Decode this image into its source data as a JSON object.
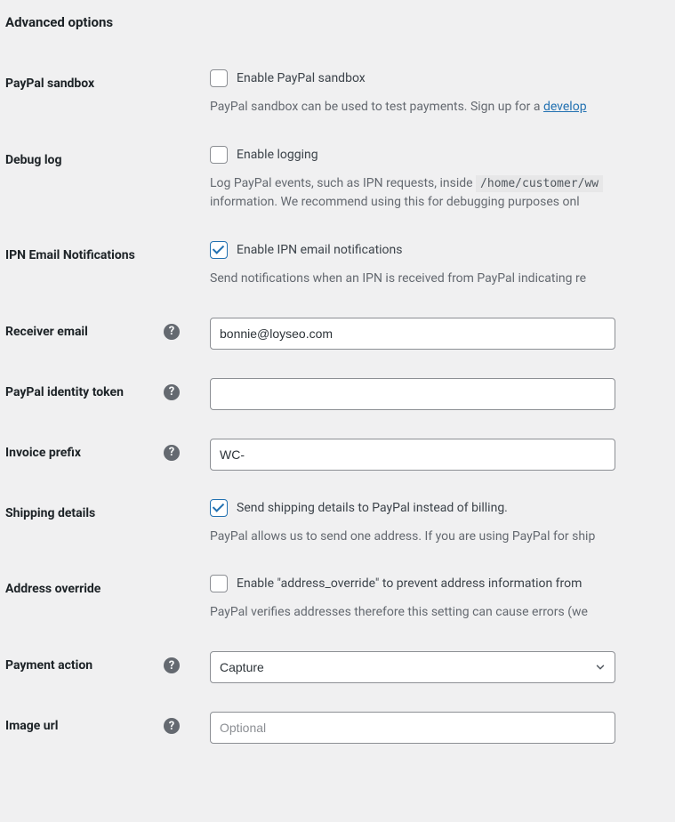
{
  "section_title": "Advanced options",
  "link_text": "develop",
  "fields": {
    "sandbox": {
      "label": "PayPal sandbox",
      "checkbox_label": "Enable PayPal sandbox",
      "description_before": "PayPal sandbox can be used to test payments. Sign up for a "
    },
    "debug_log": {
      "label": "Debug log",
      "checkbox_label": "Enable logging",
      "description_before": "Log PayPal events, such as IPN requests, inside ",
      "code": "/home/customer/ww",
      "description_line2": "information. We recommend using this for debugging purposes onl"
    },
    "ipn_notifications": {
      "label": "IPN Email Notifications",
      "checkbox_label": "Enable IPN email notifications",
      "description": "Send notifications when an IPN is received from PayPal indicating re"
    },
    "receiver_email": {
      "label": "Receiver email",
      "value": "bonnie@loyseo.com"
    },
    "identity_token": {
      "label": "PayPal identity token",
      "value": ""
    },
    "invoice_prefix": {
      "label": "Invoice prefix",
      "value": "WC-"
    },
    "shipping_details": {
      "label": "Shipping details",
      "checkbox_label": "Send shipping details to PayPal instead of billing.",
      "description": "PayPal allows us to send one address. If you are using PayPal for ship"
    },
    "address_override": {
      "label": "Address override",
      "checkbox_label": "Enable \"address_override\" to prevent address information from ",
      "description": "PayPal verifies addresses therefore this setting can cause errors (we "
    },
    "payment_action": {
      "label": "Payment action",
      "value": "Capture"
    },
    "image_url": {
      "label": "Image url",
      "placeholder": "Optional",
      "value": ""
    }
  }
}
